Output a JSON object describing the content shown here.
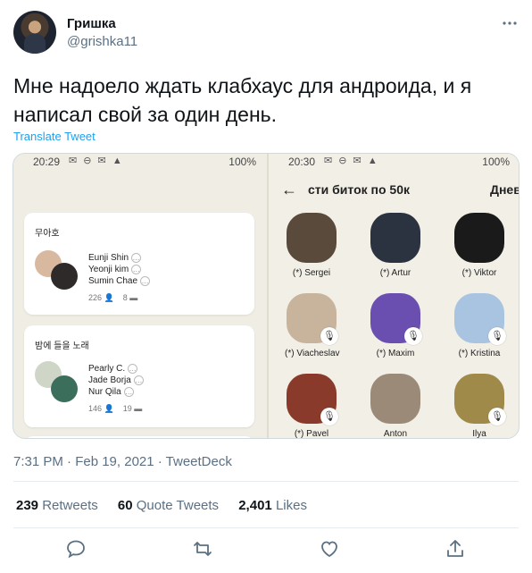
{
  "author": {
    "name": "Гришка",
    "handle": "@grishka11"
  },
  "tweet": {
    "text": "Мне надоело ждать клабхаус для андроида, и я написал свой за один день.",
    "translate_label": "Translate Tweet",
    "meta": "7:31 PM · Feb 19, 2021 · TweetDeck"
  },
  "stats": {
    "retweets_count": "239",
    "retweets_label": "Retweets",
    "quotes_count": "60",
    "quotes_label": "Quote Tweets",
    "likes_count": "2,401",
    "likes_label": "Likes"
  },
  "left_phone": {
    "status_time": "20:29",
    "status_battery": "100%",
    "rooms": [
      {
        "title": "무아호",
        "speakers": [
          "Eunji Shin",
          "Yeonji kim",
          "Sumin Chae"
        ],
        "listeners": "226",
        "speakers_count": "8"
      },
      {
        "title": "밤에 들을 노래",
        "speakers": [
          "Pearly C.",
          "Jade Borja",
          "Nur Qila"
        ],
        "listeners": "146",
        "speakers_count": "19"
      }
    ]
  },
  "right_phone": {
    "status_time": "20:30",
    "status_battery": "100%",
    "room_title": "сти биток по 50к",
    "room_title_next": "Днев",
    "people": [
      {
        "label": "(*) Sergei",
        "muted": false
      },
      {
        "label": "(*) Artur",
        "muted": false
      },
      {
        "label": "(*) Viktor",
        "muted": false
      },
      {
        "label": "(*) Viacheslav",
        "muted": true
      },
      {
        "label": "(*) Maxim",
        "muted": true
      },
      {
        "label": "(*) Kristina",
        "muted": true
      },
      {
        "label": "(*) Pavel",
        "muted": true
      },
      {
        "label": "Anton",
        "muted": false
      },
      {
        "label": "Ilya",
        "muted": true
      }
    ]
  },
  "icons": [
    "more-icon",
    "reply-icon",
    "retweet-icon",
    "like-icon",
    "share-icon",
    "back-arrow-icon",
    "mic-muted-icon"
  ],
  "colors": {
    "accent": "#1da1f2",
    "muted_text": "#5b7083"
  }
}
